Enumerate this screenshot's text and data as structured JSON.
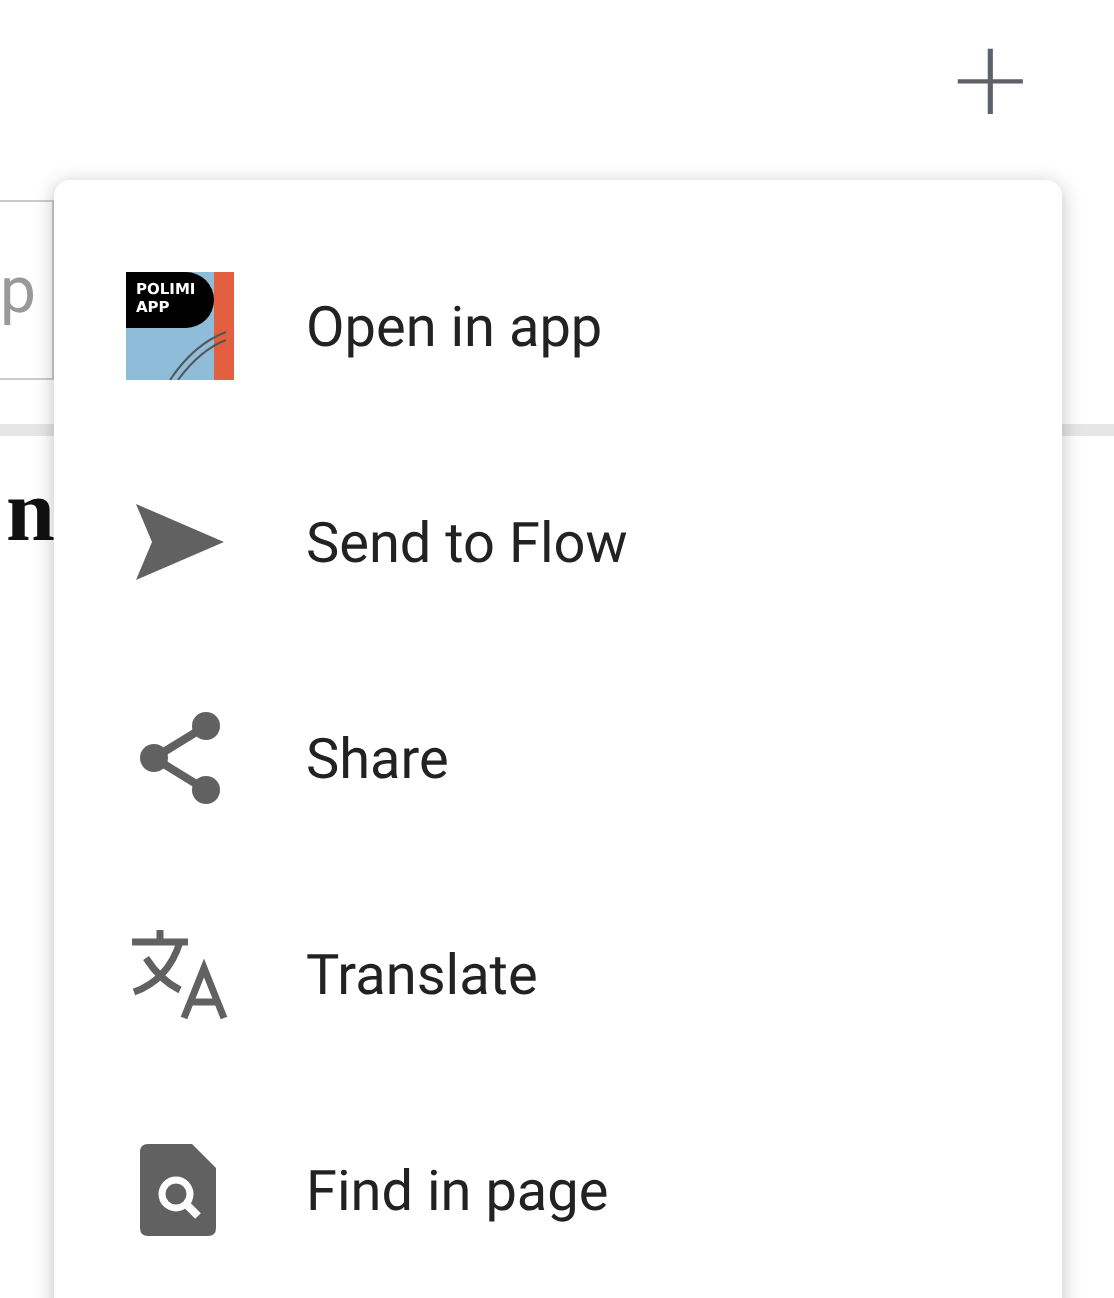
{
  "page": {
    "add_button": "+",
    "search_field": {
      "value": "p"
    },
    "heading": "n"
  },
  "menu": {
    "items": [
      {
        "kind": "app",
        "label": "Open in app",
        "logo_text": "POLIMI APP"
      },
      {
        "kind": "send",
        "label": "Send to Flow"
      },
      {
        "kind": "share",
        "label": "Share"
      },
      {
        "kind": "translate",
        "label": "Translate"
      },
      {
        "kind": "find",
        "label": "Find in page"
      }
    ]
  }
}
